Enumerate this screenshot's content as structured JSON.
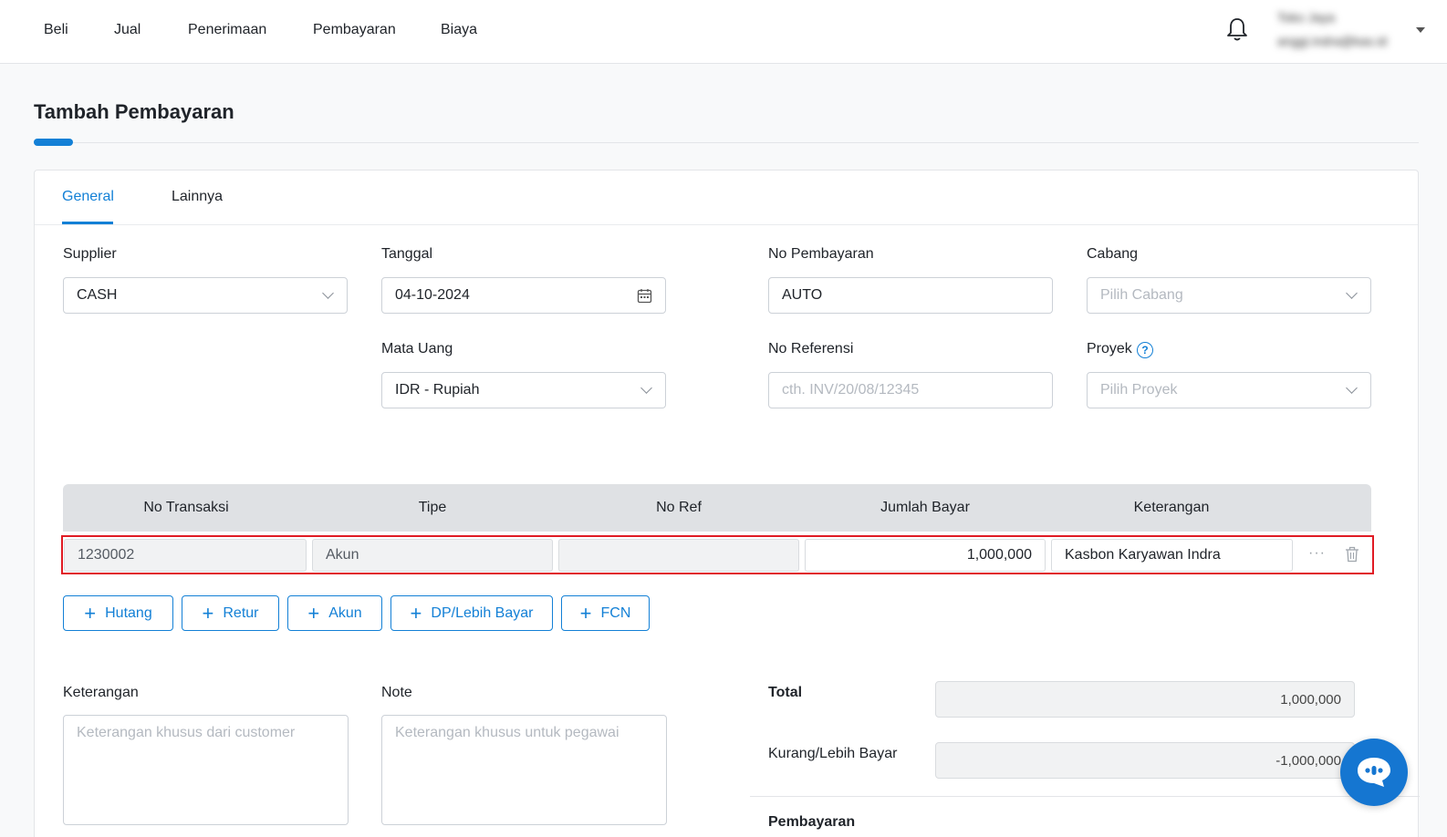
{
  "nav": {
    "items": [
      "Beli",
      "Jual",
      "Penerimaan",
      "Pembayaran",
      "Biaya"
    ],
    "user_name": "Toko Jaya",
    "user_email": "anggi.indra@kas.id"
  },
  "page": {
    "title": "Tambah Pembayaran"
  },
  "tabs": [
    "General",
    "Lainnya"
  ],
  "form": {
    "supplier_label": "Supplier",
    "supplier_value": "CASH",
    "tanggal_label": "Tanggal",
    "tanggal_value": "04-10-2024",
    "no_pembayaran_label": "No Pembayaran",
    "no_pembayaran_value": "AUTO",
    "cabang_label": "Cabang",
    "cabang_placeholder": "Pilih Cabang",
    "mata_uang_label": "Mata Uang",
    "mata_uang_value": "IDR - Rupiah",
    "no_referensi_label": "No Referensi",
    "no_referensi_placeholder": "cth. INV/20/08/12345",
    "proyek_label": "Proyek",
    "proyek_placeholder": "Pilih Proyek"
  },
  "table": {
    "headers": [
      "No Transaksi",
      "Tipe",
      "No Ref",
      "Jumlah Bayar",
      "Keterangan"
    ],
    "row": {
      "no_transaksi": "1230002",
      "tipe": "Akun",
      "no_ref": "",
      "jumlah_bayar": "1,000,000",
      "keterangan": "Kasbon Karyawan Indra"
    },
    "more_label": "···"
  },
  "add_buttons": [
    "Hutang",
    "Retur",
    "Akun",
    "DP/Lebih Bayar",
    "FCN"
  ],
  "notes": {
    "keterangan_label": "Keterangan",
    "keterangan_placeholder": "Keterangan khusus dari customer",
    "note_label": "Note",
    "note_placeholder": "Keterangan khusus untuk pegawai"
  },
  "summary": {
    "total_label": "Total",
    "total_value": "1,000,000",
    "kurang_label": "Kurang/Lebih Bayar",
    "kurang_value": "-1,000,000",
    "pembayaran_label": "Pembayaran"
  },
  "colors": {
    "accent": "#1380d6",
    "highlight": "#e01b24",
    "chat": "#1576d1"
  },
  "icons": [
    "bell-icon",
    "calendar-icon",
    "chevron-down-icon",
    "help-icon",
    "trash-icon",
    "plus-icon",
    "chat-icon"
  ]
}
